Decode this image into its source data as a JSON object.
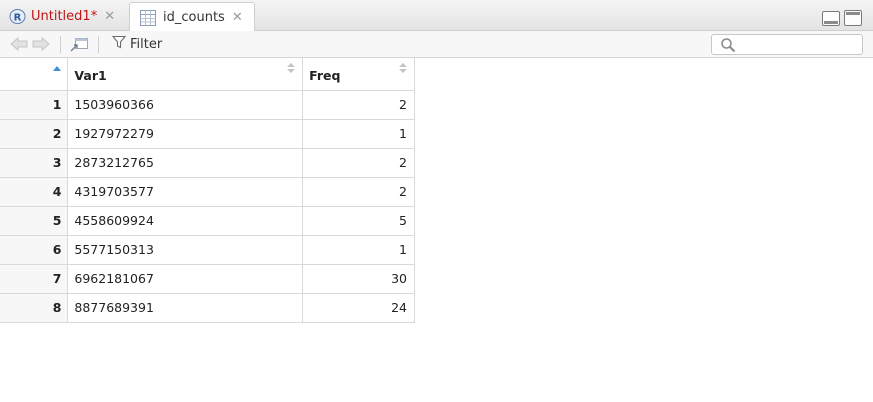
{
  "tabs": [
    {
      "label": "Untitled1*",
      "icon": "r-script-icon",
      "color": "#c01414"
    },
    {
      "label": "id_counts",
      "icon": "data-grid-icon",
      "active": true
    }
  ],
  "toolbar": {
    "filter_label": "Filter",
    "search_placeholder": ""
  },
  "table": {
    "columns": [
      "",
      "Var1",
      "Freq"
    ],
    "sort_column": 0,
    "rows": [
      {
        "idx": "1",
        "var1": "1503960366",
        "freq": "2"
      },
      {
        "idx": "2",
        "var1": "1927972279",
        "freq": "1"
      },
      {
        "idx": "3",
        "var1": "2873212765",
        "freq": "2"
      },
      {
        "idx": "4",
        "var1": "4319703577",
        "freq": "2"
      },
      {
        "idx": "5",
        "var1": "4558609924",
        "freq": "5"
      },
      {
        "idx": "6",
        "var1": "5577150313",
        "freq": "1"
      },
      {
        "idx": "7",
        "var1": "6962181067",
        "freq": "30"
      },
      {
        "idx": "8",
        "var1": "8877689391",
        "freq": "24"
      }
    ]
  },
  "colors": {
    "accent": "#3a8fd6",
    "modified_tab": "#c01414"
  }
}
